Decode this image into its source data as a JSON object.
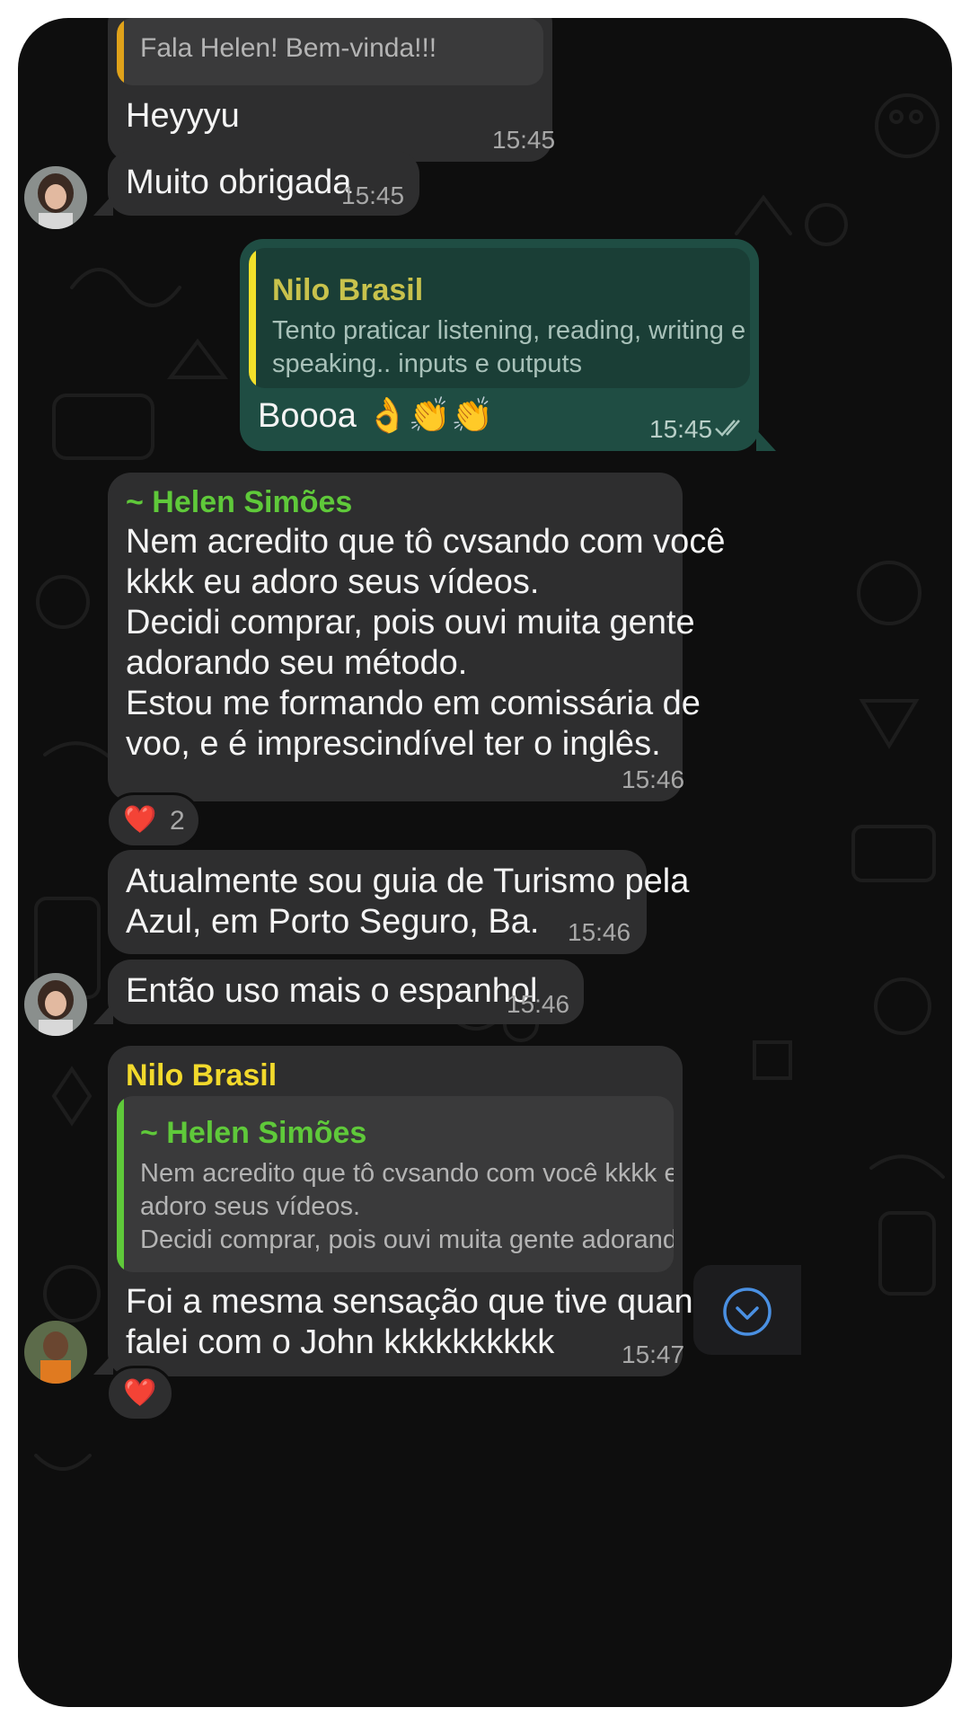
{
  "colors": {
    "background": "#0e0e0e",
    "incoming_bubble": "#2e2e2f",
    "outgoing_bubble": "#1f4d43",
    "helen_name": "#5fc93a",
    "nilo_name_yellow": "#f2d92c",
    "nilo_name_olive": "#c8c24c",
    "scroll_button_icon": "#4a90e2"
  },
  "messages": {
    "m1": {
      "quote_text": "Fala Helen! Bem-vinda!!!",
      "text": "Heyyyu",
      "time": "15:45"
    },
    "m2": {
      "text": "Muito obrigada",
      "time": "15:45"
    },
    "m3": {
      "quote_name": "Nilo Brasil",
      "quote_line1": "Tento praticar listening, reading, writing e",
      "quote_line2": "speaking.. inputs e outputs",
      "text": "Boooa 👌👏👏",
      "time": "15:45",
      "status_icon": "double-check-icon"
    },
    "m4": {
      "sender": "~ Helen Simões",
      "lines": [
        "Nem acredito que tô cvsando com você",
        "kkkk eu adoro seus vídeos.",
        "Decidi comprar, pois ouvi muita gente",
        "adorando seu método.",
        "Estou me formando em comissária de",
        "voo, e é imprescindível ter o inglês."
      ],
      "time": "15:46",
      "reaction_emoji": "❤️",
      "reaction_count": "2"
    },
    "m5": {
      "line1": "Atualmente sou guia de Turismo pela",
      "line2": "Azul, em Porto Seguro, Ba.",
      "time": "15:46"
    },
    "m6": {
      "text": "Então uso mais o espanhol",
      "time": "15:46"
    },
    "m7": {
      "sender": "Nilo Brasil",
      "quote_name": "~ Helen Simões",
      "quote_line1": "Nem acredito que tô cvsando com você kkkk eu",
      "quote_line2": "adoro seus vídeos.",
      "quote_line3": "Decidi comprar, pois ouvi muita gente adorand...",
      "line1": "Foi a mesma sensação que tive quando",
      "line2": "falei com o John kkkkkkkkkk",
      "time": "15:47",
      "reaction_emoji": "❤️"
    }
  },
  "scroll_button": {
    "icon": "chevron-down-icon"
  }
}
